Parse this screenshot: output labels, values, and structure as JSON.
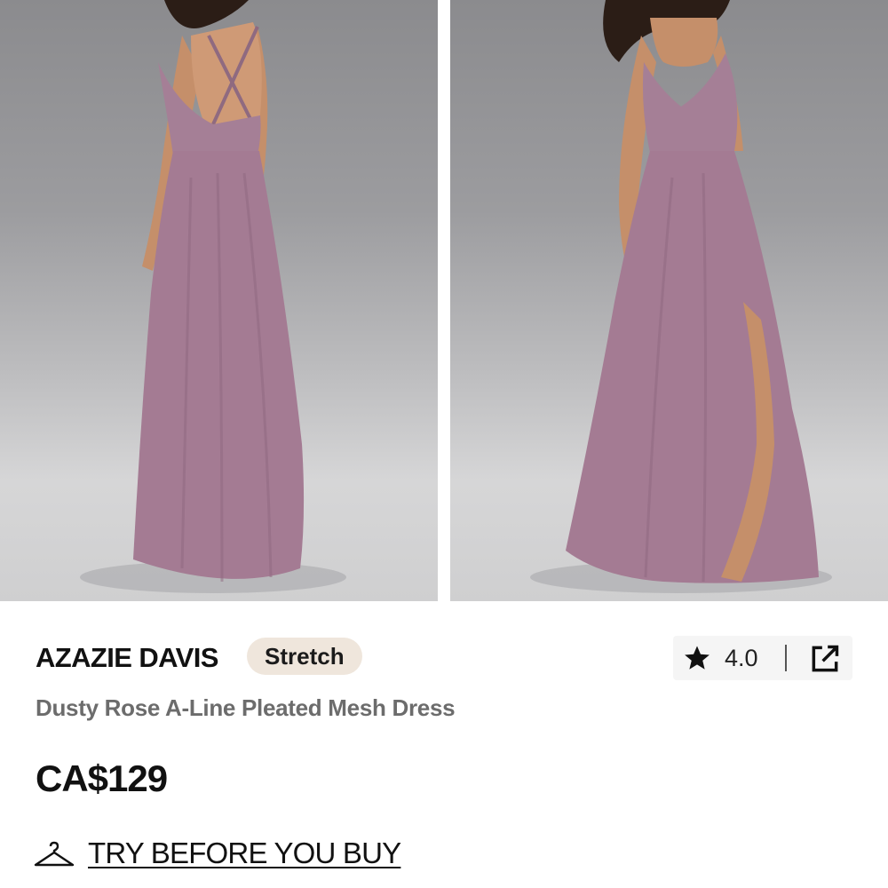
{
  "gallery": {
    "images": [
      {
        "alt": "back view of dress"
      },
      {
        "alt": "front view of dress"
      }
    ]
  },
  "product": {
    "brand": "AZAZIE DAVIS",
    "tag": "Stretch",
    "name": "Dusty Rose A-Line Pleated Mesh Dress",
    "price": "CA$129",
    "rating": "4.0"
  },
  "actions": {
    "try_before_you_buy": "TRY BEFORE YOU BUY"
  },
  "icons": {
    "rating": "star-icon",
    "share": "share-external-icon",
    "try": "hanger-icon"
  },
  "colors": {
    "dress": "#a57f96",
    "tag_bg": "#efe6dc",
    "text_primary": "#111111",
    "text_secondary": "#6c6c6c"
  }
}
